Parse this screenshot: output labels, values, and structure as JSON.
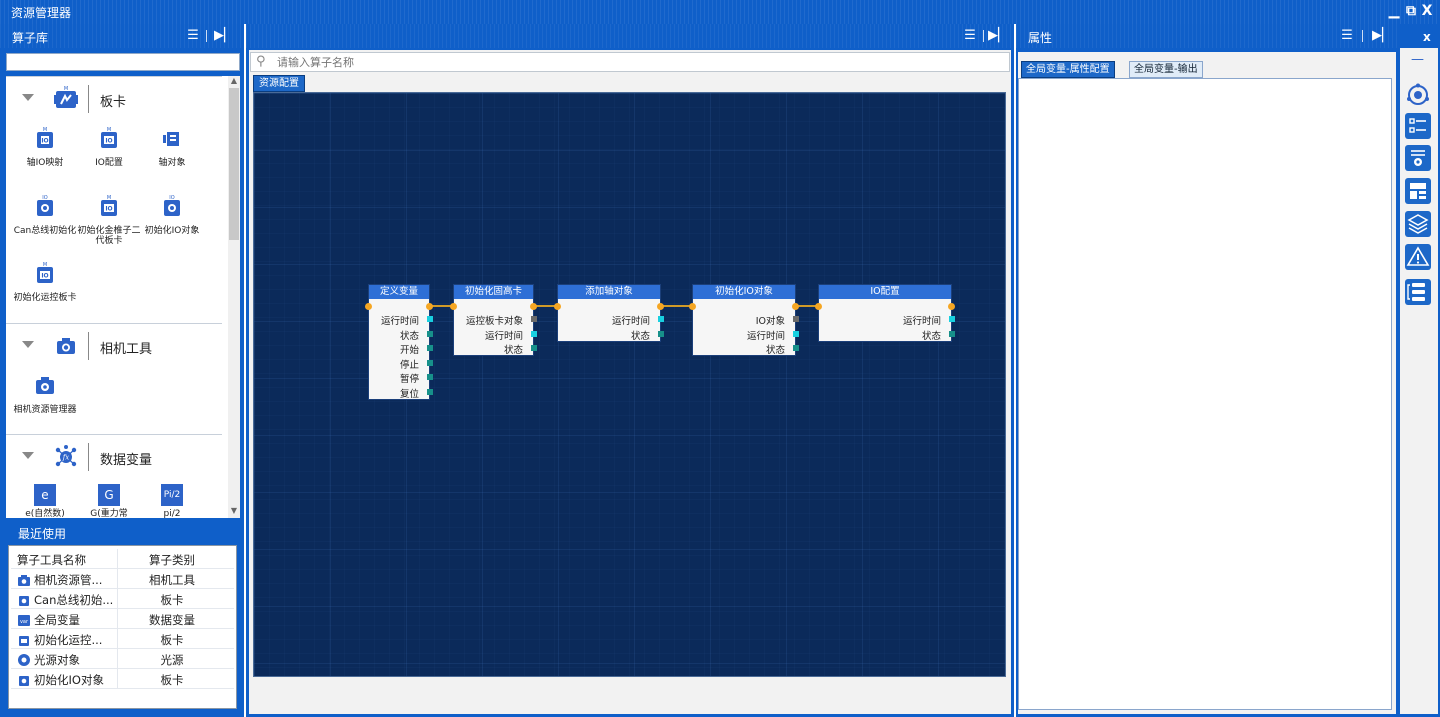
{
  "app": {
    "title": "资源管理器"
  },
  "window_controls": {
    "minimize": "▁",
    "restore": "⧉",
    "close": "X"
  },
  "left_panel": {
    "title": "算子库",
    "search_value": "",
    "categories": [
      {
        "label": "板卡",
        "icon": "board-card-icon",
        "tools": [
          {
            "label": "轴IO映射",
            "icon": "axis-io-map-icon"
          },
          {
            "label": "IO配置",
            "icon": "io-config-icon"
          },
          {
            "label": "轴对象",
            "icon": "axis-object-icon"
          },
          {
            "label": "Can总线初始化",
            "icon": "can-bus-init-icon"
          },
          {
            "label": "初始化金椎子二代板卡",
            "icon": "init-board-icon"
          },
          {
            "label": "初始化IO对象",
            "icon": "init-io-object-icon"
          },
          {
            "label": "初始化运控板卡",
            "icon": "init-motion-board-icon"
          }
        ]
      },
      {
        "label": "相机工具",
        "icon": "camera-icon",
        "tools": [
          {
            "label": "相机资源管理器",
            "icon": "camera-settings-icon"
          }
        ]
      },
      {
        "label": "数据变量",
        "icon": "data-variable-icon",
        "tools": [
          {
            "label": "e(自然数)",
            "icon": "e-constant-icon",
            "glyph": "e"
          },
          {
            "label": "G(重力常",
            "icon": "g-constant-icon",
            "glyph": "G"
          },
          {
            "label": "pi/2",
            "icon": "pi-half-icon",
            "glyph": "Pi/2"
          }
        ]
      }
    ]
  },
  "recent": {
    "title": "最近使用",
    "columns": [
      "算子工具名称",
      "算子类别"
    ],
    "rows": [
      {
        "name": "相机资源管...",
        "category": "相机工具",
        "icon": "camera-settings-icon"
      },
      {
        "name": "Can总线初始...",
        "category": "板卡",
        "icon": "board-io-icon"
      },
      {
        "name": "全局变量",
        "category": "数据变量",
        "icon": "var-icon"
      },
      {
        "name": "初始化运控...",
        "category": "板卡",
        "icon": "board-io-icon"
      },
      {
        "name": "光源对象",
        "category": "光源",
        "icon": "light-source-icon"
      },
      {
        "name": "初始化IO对象",
        "category": "板卡",
        "icon": "board-io-icon"
      }
    ]
  },
  "center": {
    "search_placeholder": "请输入算子名称",
    "tab": "资源配置",
    "nodes": [
      {
        "title": "定义变量",
        "ports": [
          "运行时间",
          "状态",
          "开始",
          "停止",
          "暂停",
          "复位"
        ]
      },
      {
        "title": "初始化固高卡",
        "ports": [
          "运控板卡对象",
          "运行时间",
          "状态"
        ]
      },
      {
        "title": "添加轴对象",
        "ports": [
          "运行时间",
          "状态"
        ]
      },
      {
        "title": "初始化IO对象",
        "ports": [
          "IO对象",
          "运行时间",
          "状态"
        ]
      },
      {
        "title": "IO配置",
        "ports": [
          "运行时间",
          "状态"
        ]
      }
    ]
  },
  "right_panel": {
    "title": "属性",
    "tabs": [
      "全局变量-属性配置",
      "全局变量-输出"
    ],
    "close": "x"
  },
  "side_toolbar": {
    "minimize": "—",
    "buttons": [
      "orbit-icon",
      "checklist-icon",
      "list-settings-icon",
      "dashboard-icon",
      "layers-icon",
      "warning-icon",
      "flow-list-icon"
    ]
  },
  "colors": {
    "accent": "#0f5fc9",
    "canvas": "#0b2a5a",
    "node_header": "#2e6fd6",
    "wire": "#d09a28",
    "port_exec": "#f5a623"
  }
}
